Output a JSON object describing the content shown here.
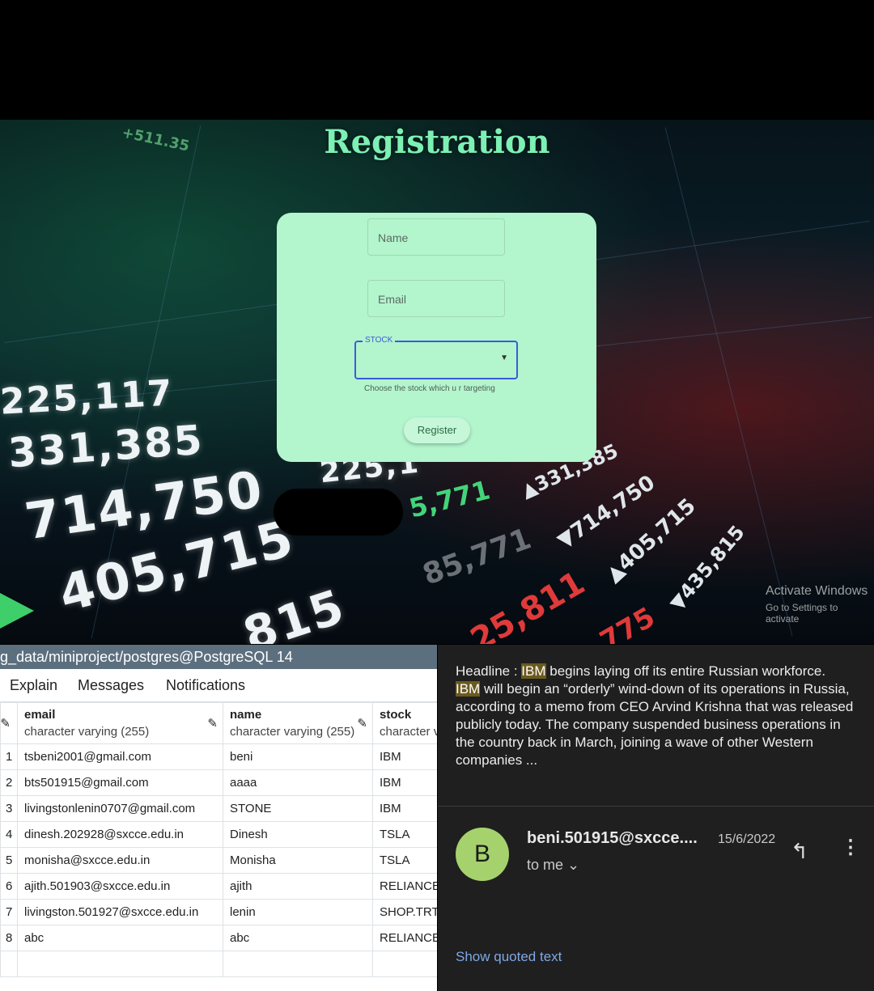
{
  "registration": {
    "title": "Registration",
    "name_placeholder": "Name",
    "email_placeholder": "Email",
    "stock_label": "STOCK",
    "stock_helper": "Choose the stock which u r targeting",
    "register_label": "Register"
  },
  "background_tickers": {
    "large": [
      "225,117",
      "331,385",
      "714,750",
      "405,715",
      "815",
      "225,1"
    ],
    "small": [
      "+511.35",
      "5,771",
      "▲331,385",
      "85,771",
      "▼714,750",
      "25,811",
      "▲405,715",
      "▼435,815",
      "775"
    ]
  },
  "watermark": {
    "line1": "Activate Windows",
    "line2": "Go to Settings to activate"
  },
  "pgadmin": {
    "title": "g_data/miniproject/postgres@PostgreSQL 14",
    "tabs": [
      "Explain",
      "Messages",
      "Notifications"
    ],
    "columns": [
      {
        "name": "email",
        "type": "character varying (255)"
      },
      {
        "name": "name",
        "type": "character varying (255)"
      },
      {
        "name": "stock",
        "type": "character v"
      }
    ],
    "rows": [
      [
        "1",
        "tsbeni2001@gmail.com",
        "beni",
        "IBM"
      ],
      [
        "2",
        "bts501915@gmail.com",
        "aaaa",
        "IBM"
      ],
      [
        "3",
        "livingstonlenin0707@gmail.com",
        "STONE",
        "IBM"
      ],
      [
        "4",
        "dinesh.202928@sxcce.edu.in",
        "Dinesh",
        "TSLA"
      ],
      [
        "5",
        "monisha@sxcce.edu.in",
        "Monisha",
        "TSLA"
      ],
      [
        "6",
        "ajith.501903@sxcce.edu.in",
        "ajith",
        "RELIANCE"
      ],
      [
        "7",
        "livingston.501927@sxcce.edu.in",
        "lenin",
        "SHOP.TRT"
      ],
      [
        "8",
        "abc",
        "abc",
        "RELIANCE"
      ]
    ]
  },
  "email": {
    "headline_prefix": "Headline : ",
    "highlight": "IBM",
    "headline_rest": " begins laying off its entire Russian workforce.",
    "body_rest": " will begin an “orderly” wind-down of its operations in Russia, according to a memo from CEO Arvind Krishna that was released publicly today. The company suspended business operations in the country back in March, joining a wave of other Western companies ...",
    "avatar_letter": "B",
    "sender": "beni.501915@sxcce....",
    "date": "15/6/2022",
    "to": "to me",
    "to_icon": "⌄",
    "reply_icon": "↰",
    "more_icon": "⋮",
    "show_quoted": "Show quoted text"
  },
  "colors": {
    "card": "#b3f5cd",
    "title_green": "#7df0b4",
    "pg_header": "#5c6f7f",
    "mail_bg": "#1f1f1f",
    "avatar": "#a5d26c",
    "link": "#7fa8e6"
  }
}
